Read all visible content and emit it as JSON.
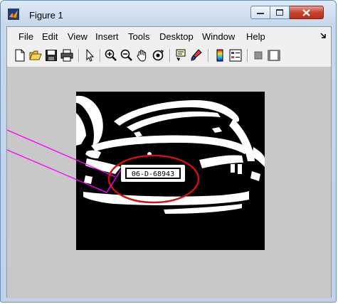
{
  "window": {
    "title": "Figure 1"
  },
  "menu": [
    "File",
    "Edit",
    "View",
    "Insert",
    "Tools",
    "Desktop",
    "Window",
    "Help"
  ],
  "plate": {
    "text": "06-D-68943"
  },
  "colors": {
    "annotation_line": "#ff00ff",
    "ellipse": "#cc1111",
    "figure_bg": "#c8c8c8"
  }
}
